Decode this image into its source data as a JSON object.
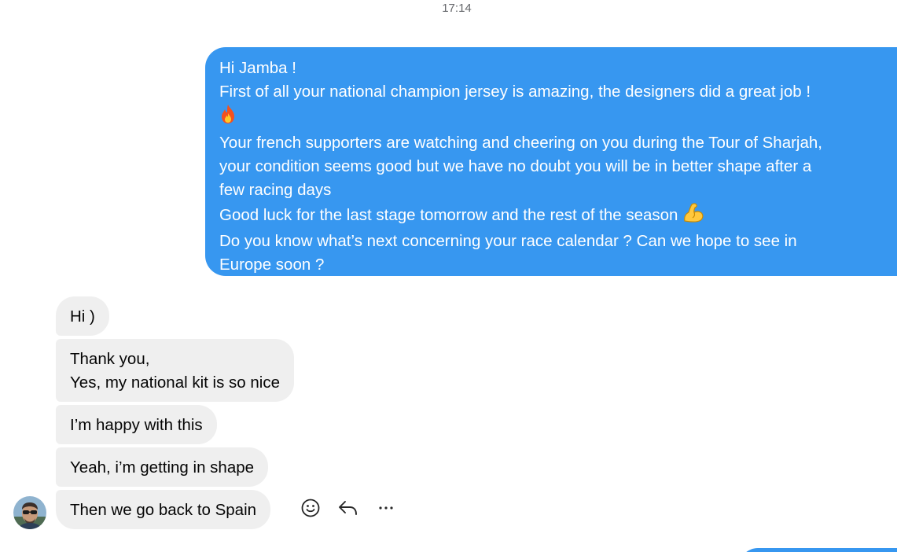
{
  "chat": {
    "timestamp": "17:14",
    "outgoing_message": {
      "lines": [
        "Hi Jamba !",
        "First of all your national champion jersey is amazing, the designers did a great job !",
        "Your french supporters are watching and cheering on you during the Tour of Sharjah,",
        "your condition seems good but we have no doubt you will be in better shape after a",
        "few racing days",
        "Good luck for the last stage tomorrow and the rest of the season",
        "Do you know what’s next concerning your race calendar ? Can we hope to see in",
        "Europe soon ?"
      ],
      "emojis": [
        "fire-emoji",
        "flexed-biceps-emoji"
      ]
    },
    "incoming_messages": [
      {
        "lines": [
          "Hi )"
        ]
      },
      {
        "lines": [
          "Thank you,",
          "Yes, my national kit is so nice"
        ]
      },
      {
        "lines": [
          "I’m happy with this"
        ]
      },
      {
        "lines": [
          "Yeah, i’m getting in shape"
        ]
      },
      {
        "lines": [
          "Then we go back to Spain"
        ]
      }
    ],
    "message_actions": {
      "icons": [
        "react-icon",
        "reply-icon",
        "more-icon"
      ]
    },
    "colors": {
      "outgoing_bubble": "#3797f0",
      "incoming_bubble": "#efefef",
      "timestamp_text": "#65676b"
    }
  }
}
